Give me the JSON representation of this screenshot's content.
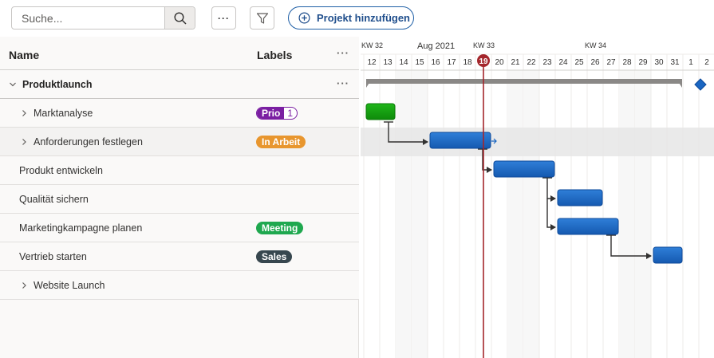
{
  "toolbar": {
    "search_placeholder": "Suche...",
    "search_icon": "search-icon",
    "more_icon": "more-icon",
    "filter_icon": "filter-icon",
    "add_project_label": "Projekt hinzufügen"
  },
  "grid": {
    "col_name": "Name",
    "col_labels": "Labels",
    "group": {
      "name": "Produktlaunch"
    },
    "rows": [
      {
        "name": "Marktanalyse",
        "expandable": true,
        "tag": {
          "text": "Prio",
          "count": "1",
          "color": "#7a1fa2"
        }
      },
      {
        "name": "Anforderungen festlegen",
        "expandable": true,
        "tag": {
          "text": "In Arbeit",
          "color": "#e8962e"
        }
      },
      {
        "name": "Produkt entwickeln",
        "expandable": false
      },
      {
        "name": "Qualität sichern",
        "expandable": false
      },
      {
        "name": "Marketingkampagne planen",
        "expandable": false,
        "tag": {
          "text": "Meeting",
          "color": "#1fa84f"
        }
      },
      {
        "name": "Vertrieb starten",
        "expandable": false,
        "tag": {
          "text": "Sales",
          "color": "#37474f"
        }
      },
      {
        "name": "Website Launch",
        "expandable": true
      }
    ]
  },
  "timeline": {
    "month_label": "Aug 2021",
    "weeks": [
      {
        "label": "KW 32",
        "day": 12
      },
      {
        "label": "KW 33",
        "day": 19
      },
      {
        "label": "KW 34",
        "day": 26
      }
    ],
    "days": [
      12,
      13,
      14,
      15,
      16,
      17,
      18,
      19,
      20,
      21,
      22,
      23,
      24,
      25,
      26,
      27,
      28,
      29,
      30,
      31,
      1,
      2
    ],
    "today": 19,
    "colors": {
      "task": "#1a66c2",
      "done": "#13a10e",
      "summary": "#8a8886",
      "today": "#a4262c",
      "milestone": "#1a66c2"
    }
  }
}
